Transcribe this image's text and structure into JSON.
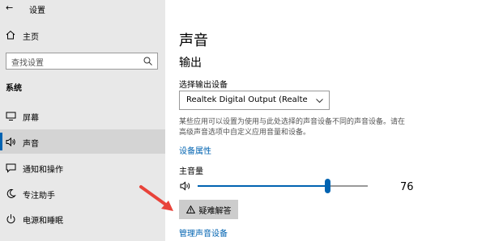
{
  "window": {
    "title": "设置",
    "back_glyph": "←"
  },
  "sidebar": {
    "home_label": "主页",
    "search_placeholder": "查找设置",
    "section_label": "系统",
    "items": [
      {
        "label": "屏幕",
        "icon": "monitor-icon"
      },
      {
        "label": "声音",
        "icon": "speaker-icon",
        "selected": true
      },
      {
        "label": "通知和操作",
        "icon": "notification-icon"
      },
      {
        "label": "专注助手",
        "icon": "moon-icon"
      },
      {
        "label": "电源和睡眠",
        "icon": "power-icon"
      }
    ]
  },
  "main": {
    "title": "声音",
    "output_section": "输出",
    "select_label": "选择输出设备",
    "selected_device": "Realtek Digital Output (Realtek(R) A...",
    "description": "某些应用可以设置为使用与此处选择的声音设备不同的声音设备。请在高级声音选项中自定义应用音量和设备。",
    "device_properties_link": "设备属性",
    "master_volume_label": "主音量",
    "volume_value": "76",
    "volume_level": 0.76,
    "troubleshoot_label": "疑难解答",
    "manage_devices_link": "管理声音设备"
  },
  "colors": {
    "accent": "#0063b1",
    "sidebar_bg": "#e8e8e8",
    "annotation_arrow": "#e8433a"
  }
}
